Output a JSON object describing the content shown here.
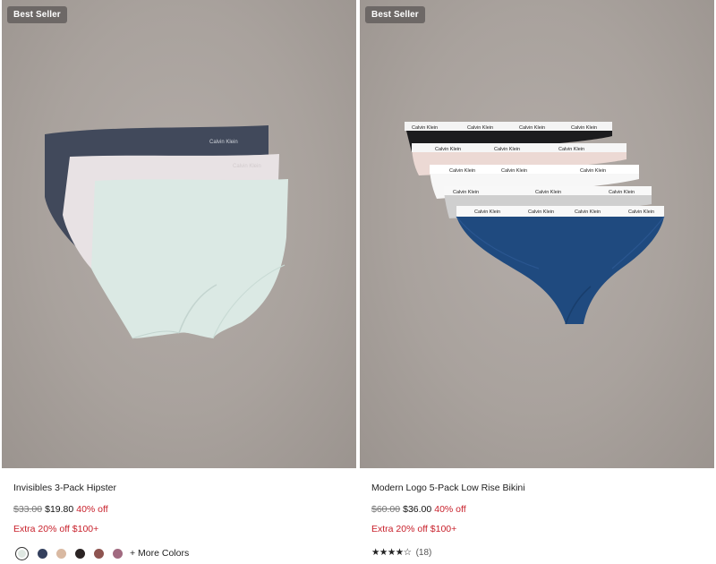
{
  "products": [
    {
      "badge": "Best Seller",
      "name": "Invisibles 3-Pack Hipster",
      "original_price": "$33.00",
      "sale_price": "$19.80",
      "discount": "40% off",
      "promo": "Extra 20% off $100+",
      "swatches": [
        "#dfe8e2",
        "#34405e",
        "#d9b9a2",
        "#2b2424",
        "#8e5450",
        "#a16a80"
      ],
      "more_colors": "+ More Colors",
      "waistband_text": "Calvin Klein"
    },
    {
      "badge": "Best Seller",
      "name": "Modern Logo 5-Pack Low Rise Bikini",
      "original_price": "$60.00",
      "sale_price": "$36.00",
      "discount": "40% off",
      "promo": "Extra 20% off $100+",
      "rating_stars": "★★★★☆",
      "review_count": "(18)",
      "waistband_text": "Calvin Klein"
    }
  ],
  "colors": {
    "sale_red": "#c8202b",
    "badge_bg": "#6d6866",
    "background_tone": "#aaa39e"
  }
}
